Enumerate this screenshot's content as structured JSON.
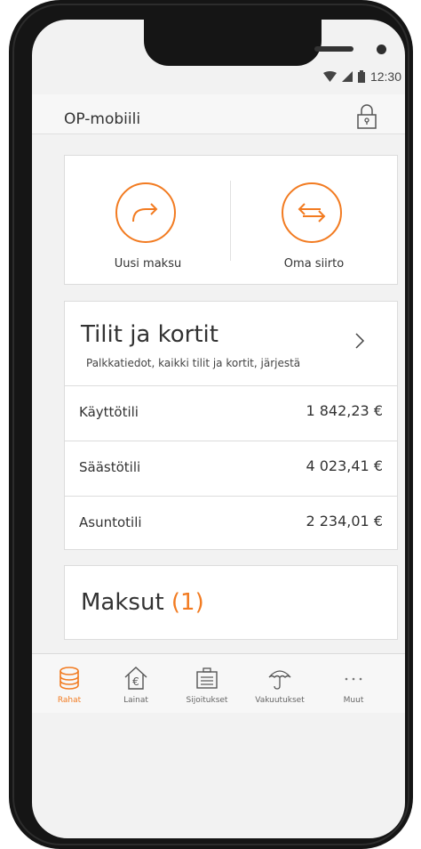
{
  "status_bar": {
    "time": "12:30"
  },
  "app_bar": {
    "title": "OP-mobiili"
  },
  "quick_actions": [
    {
      "label": "Uusi maksu"
    },
    {
      "label": "Oma siirto"
    }
  ],
  "accounts_card": {
    "title": "Tilit ja kortit",
    "subtitle": "Palkkatiedot, kaikki tilit ja kortit, järjestä",
    "rows": [
      {
        "name": "Käyttötili",
        "balance": "1 842,23 €"
      },
      {
        "name": "Säästötili",
        "balance": "4 023,41 €"
      },
      {
        "name": "Asuntotili",
        "balance": "2 234,01 €"
      }
    ]
  },
  "payments_card": {
    "title": "Maksut",
    "count": "(1)"
  },
  "tab_bar": {
    "items": [
      {
        "label": "Rahat",
        "icon": "coins-icon",
        "active": true
      },
      {
        "label": "Lainat",
        "icon": "house-euro-icon",
        "active": false
      },
      {
        "label": "Sijoitukset",
        "icon": "briefcase-icon",
        "active": false
      },
      {
        "label": "Vakuutukset",
        "icon": "umbrella-icon",
        "active": false
      },
      {
        "label": "Muut",
        "icon": "more-dots-icon",
        "active": false
      }
    ]
  },
  "colors": {
    "accent": "#f27b21",
    "background": "#f2f2f2",
    "card": "#ffffff",
    "text": "#333333"
  }
}
